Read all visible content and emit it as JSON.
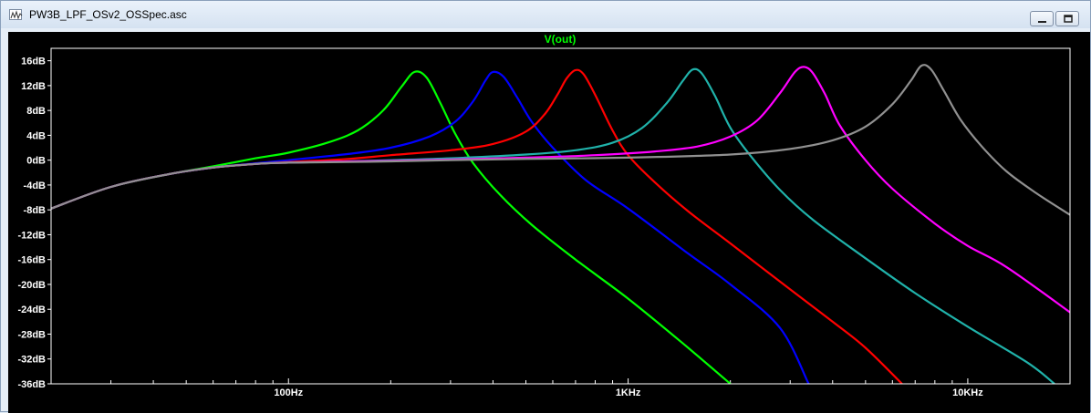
{
  "window": {
    "title": "PW3B_LPF_OSv2_OSSpec.asc",
    "icon": "waveform-document-icon",
    "buttons": [
      "minimize-icon",
      "restore-icon",
      "close-icon"
    ]
  },
  "chart_data": {
    "type": "line",
    "title": "V(out)",
    "xlabel": "",
    "ylabel": "",
    "xscale": "log",
    "xlim": [
      20,
      20000
    ],
    "ylim": [
      -36,
      18
    ],
    "grid": false,
    "x_tick_labels": [
      {
        "value": 100,
        "label": "100Hz"
      },
      {
        "value": 1000,
        "label": "1KHz"
      },
      {
        "value": 10000,
        "label": "10KHz"
      }
    ],
    "y_tick_labels": [
      {
        "value": 16,
        "label": "16dB"
      },
      {
        "value": 12,
        "label": "12dB"
      },
      {
        "value": 8,
        "label": "8dB"
      },
      {
        "value": 4,
        "label": "4dB"
      },
      {
        "value": 0,
        "label": "0dB"
      },
      {
        "value": -4,
        "label": "-4dB"
      },
      {
        "value": -8,
        "label": "-8dB"
      },
      {
        "value": -12,
        "label": "-12dB"
      },
      {
        "value": -16,
        "label": "-16dB"
      },
      {
        "value": -20,
        "label": "-20dB"
      },
      {
        "value": -24,
        "label": "-24dB"
      },
      {
        "value": -28,
        "label": "-28dB"
      },
      {
        "value": -32,
        "label": "-32dB"
      },
      {
        "value": -36,
        "label": "-36dB"
      }
    ],
    "colors": {
      "background": "#000000",
      "frame": "#ffffff",
      "title": "#00ff00",
      "tick_label": "#ffffff"
    },
    "series": [
      {
        "color": "#00ff00",
        "x": [
          20,
          30,
          45,
          60,
          80,
          100,
          130,
          160,
          190,
          215,
          235,
          255,
          280,
          310,
          350,
          420,
          520,
          700,
          1000,
          1450,
          2000
        ],
        "y": [
          -7.8,
          -4.3,
          -2.2,
          -1.0,
          0.3,
          1.2,
          2.8,
          4.8,
          8.0,
          11.8,
          14.2,
          13.3,
          9.2,
          4.2,
          -0.5,
          -5.6,
          -10.4,
          -16.0,
          -22.3,
          -29.5,
          -36.0
        ]
      },
      {
        "color": "#0000ff",
        "x": [
          20,
          30,
          45,
          60,
          80,
          100,
          150,
          200,
          260,
          310,
          350,
          380,
          400,
          430,
          470,
          520,
          600,
          750,
          1000,
          1500,
          2000,
          2800,
          3400
        ],
        "y": [
          -7.8,
          -4.3,
          -2.2,
          -1.2,
          -0.5,
          0.0,
          1.0,
          2.0,
          3.8,
          6.2,
          9.5,
          12.8,
          14.2,
          13.4,
          10.2,
          6.2,
          2.0,
          -3.2,
          -7.8,
          -15.0,
          -20.0,
          -27.0,
          -36.0
        ]
      },
      {
        "color": "#ff0000",
        "x": [
          20,
          30,
          45,
          60,
          80,
          100,
          150,
          200,
          300,
          400,
          500,
          570,
          620,
          660,
          700,
          740,
          800,
          900,
          1000,
          1200,
          1500,
          2000,
          3000,
          4000,
          5000,
          6400
        ],
        "y": [
          -7.8,
          -4.3,
          -2.2,
          -1.2,
          -0.6,
          -0.3,
          0.2,
          0.8,
          1.6,
          2.6,
          4.6,
          7.5,
          10.6,
          13.2,
          14.5,
          13.8,
          10.5,
          4.8,
          0.8,
          -3.6,
          -8.2,
          -13.4,
          -20.8,
          -26.0,
          -30.2,
          -36.0
        ]
      },
      {
        "color": "#20b2aa",
        "x": [
          20,
          30,
          45,
          60,
          80,
          100,
          150,
          200,
          300,
          500,
          700,
          900,
          1100,
          1300,
          1450,
          1550,
          1650,
          1800,
          2000,
          2300,
          2800,
          3500,
          5000,
          7000,
          10000,
          15000,
          18000
        ],
        "y": [
          -7.8,
          -4.3,
          -2.2,
          -1.2,
          -0.6,
          -0.4,
          -0.2,
          0.0,
          0.3,
          0.9,
          1.6,
          2.8,
          5.2,
          9.2,
          12.8,
          14.6,
          13.9,
          10.4,
          5.2,
          0.6,
          -4.8,
          -9.6,
          -15.8,
          -21.4,
          -26.8,
          -32.6,
          -36.0
        ]
      },
      {
        "color": "#ff00ff",
        "x": [
          20,
          30,
          45,
          60,
          80,
          100,
          150,
          200,
          300,
          500,
          800,
          1200,
          1600,
          2000,
          2400,
          2800,
          3100,
          3300,
          3500,
          3800,
          4200,
          5000,
          6000,
          8000,
          10000,
          13000,
          20000
        ],
        "y": [
          -7.8,
          -4.3,
          -2.2,
          -1.2,
          -0.6,
          -0.4,
          -0.2,
          -0.1,
          0.1,
          0.4,
          0.8,
          1.4,
          2.2,
          3.8,
          6.4,
          10.8,
          14.2,
          15.0,
          14.0,
          10.6,
          5.6,
          0.0,
          -4.6,
          -10.2,
          -13.8,
          -17.2,
          -24.5
        ]
      },
      {
        "color": "#909090",
        "x": [
          20,
          30,
          45,
          60,
          80,
          100,
          150,
          200,
          300,
          500,
          1000,
          2000,
          3000,
          4000,
          5000,
          6000,
          6800,
          7300,
          7800,
          8500,
          9500,
          11000,
          13000,
          16000,
          20000
        ],
        "y": [
          -7.8,
          -4.3,
          -2.2,
          -1.2,
          -0.6,
          -0.4,
          -0.3,
          -0.2,
          0.0,
          0.2,
          0.4,
          0.9,
          1.8,
          3.2,
          5.4,
          9.0,
          12.8,
          15.2,
          14.6,
          11.2,
          6.6,
          2.2,
          -1.8,
          -5.4,
          -8.8
        ]
      }
    ]
  }
}
